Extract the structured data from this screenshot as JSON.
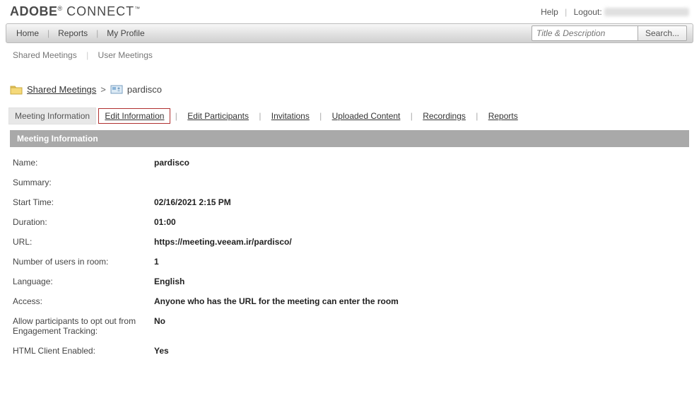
{
  "header": {
    "logo_adobe": "ADOBE",
    "logo_connect": "CONNECT",
    "help": "Help",
    "logout": "Logout:"
  },
  "nav": {
    "home": "Home",
    "reports": "Reports",
    "my_profile": "My Profile",
    "search_placeholder": "Title & Description",
    "search_btn": "Search..."
  },
  "subnav": {
    "shared": "Shared Meetings",
    "user": "User Meetings"
  },
  "breadcrumb": {
    "shared": "Shared Meetings",
    "current": "pardisco"
  },
  "tabs": {
    "meeting_info": "Meeting Information",
    "edit_info": "Edit Information",
    "edit_participants": "Edit Participants",
    "invitations": "Invitations",
    "uploaded_content": "Uploaded Content",
    "recordings": "Recordings",
    "reports": "Reports"
  },
  "panel": {
    "title": "Meeting Information",
    "labels": {
      "name": "Name:",
      "summary": "Summary:",
      "start_time": "Start Time:",
      "duration": "Duration:",
      "url": "URL:",
      "num_users": "Number of users in room:",
      "language": "Language:",
      "access": "Access:",
      "opt_out": "Allow participants to opt out from Engagement Tracking:",
      "html_client": "HTML Client Enabled:"
    },
    "values": {
      "name": "pardisco",
      "summary": "",
      "start_time": "02/16/2021 2:15 PM",
      "duration": "01:00",
      "url": "https://meeting.veeam.ir/pardisco/",
      "num_users": "1",
      "language": "English",
      "access": "Anyone who has the URL for the meeting can enter the room",
      "opt_out": "No",
      "html_client": "Yes"
    }
  }
}
